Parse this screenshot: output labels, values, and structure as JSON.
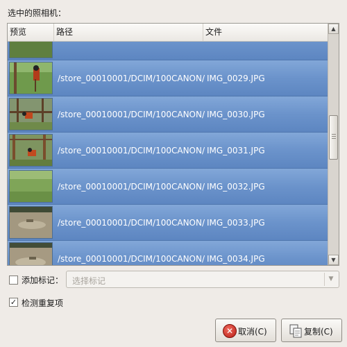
{
  "camera_label": "选中的照相机：",
  "list": {
    "columns": {
      "preview": "预览",
      "path": "路径",
      "file": "文件"
    },
    "rows": [
      {
        "path": "",
        "file": "",
        "thumb": "top-strip"
      },
      {
        "path": "/store_00010001/DCIM/100CANON/",
        "file": "IMG_0029.JPG",
        "thumb": "monkey-grass"
      },
      {
        "path": "/store_00010001/DCIM/100CANON/",
        "file": "IMG_0030.JPG",
        "thumb": "monkey-ropes"
      },
      {
        "path": "/store_00010001/DCIM/100CANON/",
        "file": "IMG_0031.JPG",
        "thumb": "monkey-posts"
      },
      {
        "path": "/store_00010001/DCIM/100CANON/",
        "file": "IMG_0032.JPG",
        "thumb": "grass-field"
      },
      {
        "path": "/store_00010001/DCIM/100CANON/",
        "file": "IMG_0033.JPG",
        "thumb": "sand-ground"
      },
      {
        "path": "/store_00010001/DCIM/100CANON/",
        "file": "IMG_0034.JPG",
        "thumb": "sand-ground-2"
      },
      {
        "path": "",
        "file": "",
        "thumb": "sand-ground-3"
      }
    ],
    "scroll_up_icon": "arrow-up-icon",
    "scroll_down_icon": "arrow-down-icon"
  },
  "tag": {
    "checked": false,
    "label": "添加标记：",
    "placeholder": "选择标记",
    "dropdown_icon": "chevron-down-icon"
  },
  "detect_duplicates": {
    "checked": true,
    "label": "检测重复项"
  },
  "buttons": {
    "cancel_label": "取消(C)",
    "copy_label": "复制(C)",
    "cancel_icon": "cancel-icon",
    "copy_icon": "copy-icon"
  },
  "colors": {
    "selection": "#6b93cb",
    "window_bg": "#efebe7"
  }
}
